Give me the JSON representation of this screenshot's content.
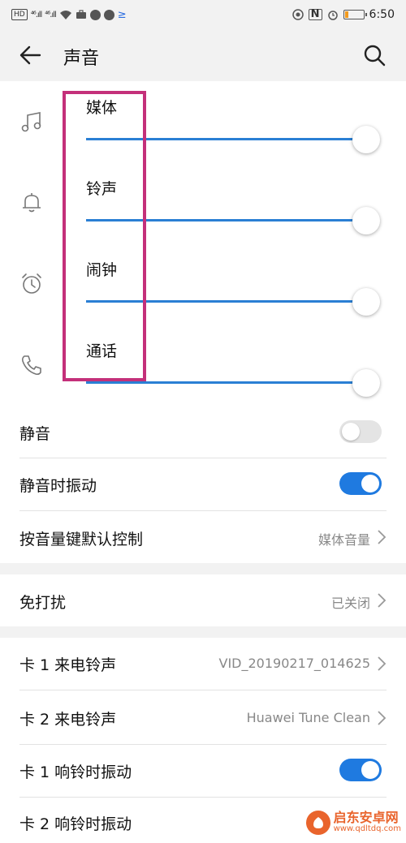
{
  "status_bar": {
    "hd_badge": "HD",
    "sig1": "⁴⁶.ıll",
    "sig2": "⁴⁶.ıll",
    "nfc": "N",
    "time": "6:50",
    "battery_level": 0.2
  },
  "title_bar": {
    "title": "声音"
  },
  "volume": {
    "items": [
      {
        "label": "媒体",
        "icon": "music-note-icon",
        "level": 1.0
      },
      {
        "label": "铃声",
        "icon": "bell-icon",
        "level": 1.0
      },
      {
        "label": "闹钟",
        "icon": "alarm-clock-icon",
        "level": 1.0
      },
      {
        "label": "通话",
        "icon": "phone-icon",
        "level": 1.0
      }
    ]
  },
  "settings": {
    "mute": {
      "label": "静音",
      "on": false
    },
    "vibrate_on_mute": {
      "label": "静音时振动",
      "on": true
    },
    "volume_key": {
      "label": "按音量键默认控制",
      "value": "媒体音量"
    },
    "dnd": {
      "label": "免打扰",
      "value": "已关闭"
    },
    "sim1_ringtone": {
      "label": "卡 1 来电铃声",
      "value": "VID_20190217_014625"
    },
    "sim2_ringtone": {
      "label": "卡 2 来电铃声",
      "value": "Huawei Tune Clean"
    },
    "sim1_vibrate": {
      "label": "卡 1 响铃时振动",
      "on": true
    },
    "sim2_vibrate": {
      "label": "卡 2 响铃时振动"
    }
  },
  "watermark": {
    "name": "启东安卓网",
    "url": "www.qdltdq.com"
  },
  "colors": {
    "accent": "#1f7ae0",
    "slider": "#2a7fd4",
    "highlight": "#c4307a",
    "background_gray": "#f2f2f2"
  }
}
